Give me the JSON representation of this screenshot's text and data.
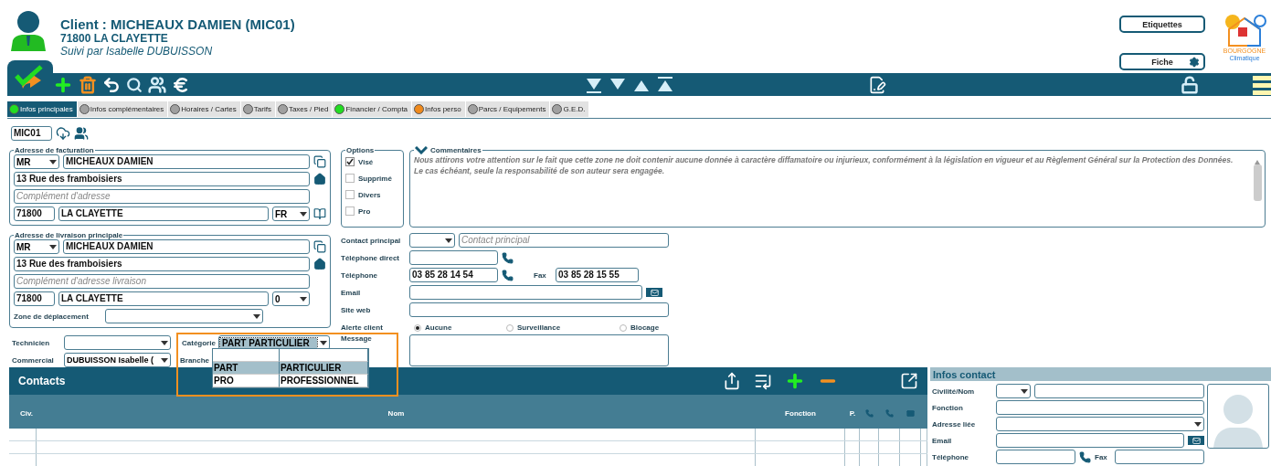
{
  "header": {
    "title": "Client : MICHEAUX DAMIEN (MIC01)",
    "city": "71800 LA CLAYETTE",
    "followed_by": "Suivi par Isabelle DUBUISSON",
    "buttons": [
      "Etiquettes",
      "Fiche"
    ],
    "logo": {
      "line1": "BOURGOGNE",
      "line2": "Climatique"
    }
  },
  "tabs": [
    {
      "label": "Infos principales",
      "color": "#22dd22",
      "selected": true
    },
    {
      "label": "Infos complémentaires",
      "color": "#a0a0a0",
      "selected": false
    },
    {
      "label": "Horaires / Cartes",
      "color": "#a0a0a0",
      "selected": false
    },
    {
      "label": "Tarifs",
      "color": "#a0a0a0",
      "selected": false
    },
    {
      "label": "Taxes / Pied",
      "color": "#a0a0a0",
      "selected": false
    },
    {
      "label": "Financier / Compta",
      "color": "#22dd22",
      "selected": false
    },
    {
      "label": "Infos perso",
      "color": "#f08a1c",
      "selected": false
    },
    {
      "label": "Parcs / Equipements",
      "color": "#a0a0a0",
      "selected": false
    },
    {
      "label": "G.E.D.",
      "color": "#a0a0a0",
      "selected": false
    }
  ],
  "code": "MIC01",
  "billing": {
    "legend": "Adresse de facturation",
    "civility": "MR",
    "name": "MICHEAUX DAMIEN",
    "street": "13 Rue des framboisiers",
    "complement_placeholder": "Complément d'adresse",
    "zip": "71800",
    "city": "LA CLAYETTE",
    "country": "FR"
  },
  "delivery": {
    "legend": "Adresse de livraison principale",
    "civility": "MR",
    "name": "MICHEAUX DAMIEN",
    "street": "13 Rue des framboisiers",
    "complement_placeholder": "Complément d'adresse livraison",
    "zip": "71800",
    "city": "LA CLAYETTE",
    "country": "0",
    "zone_label": "Zone de déplacement"
  },
  "assign": {
    "technician_label": "Technicien",
    "category_label": "Catégorie",
    "category": "PART PARTICULIER",
    "commercial_label": "Commercial",
    "commercial": "DUBUISSON Isabelle (",
    "branch_label": "Branche"
  },
  "category_dropdown": [
    {
      "code": "PART",
      "label": "PARTICULIER",
      "selected": true
    },
    {
      "code": "PRO",
      "label": "PROFESSIONNEL",
      "selected": false
    }
  ],
  "options": {
    "legend": "Options",
    "items": [
      {
        "label": "Visé",
        "checked": true
      },
      {
        "label": "Supprimé",
        "checked": false
      },
      {
        "label": "Divers",
        "checked": false
      },
      {
        "label": "Pro",
        "checked": false
      }
    ]
  },
  "comments": {
    "legend": "Commentaires",
    "text": "Nous attirons votre attention sur le fait que cette zone ne doit contenir aucune donnée à caractère diffamatoire ou injurieux, conformément à la législation en vigueur et au Règlement Général sur la Protection des Données. Le cas échéant, seule la responsabilité de son auteur sera engagée."
  },
  "contact": {
    "principal_label": "Contact principal",
    "principal_placeholder": "Contact principal",
    "direct_label": "Téléphone direct",
    "phone_label": "Téléphone",
    "phone": "03 85 28 14 54",
    "fax_label": "Fax",
    "fax": "03 85 28 15 55",
    "email_label": "Email",
    "web_label": "Site web",
    "alert_label": "Alerte client",
    "alerts": [
      {
        "label": "Aucune",
        "selected": true
      },
      {
        "label": "Surveillance",
        "selected": false
      },
      {
        "label": "Blocage",
        "selected": false
      }
    ],
    "message_label": "Message"
  },
  "contacts": {
    "title": "Contacts",
    "columns": [
      "Civ.",
      "Nom",
      "Fonction",
      "P."
    ]
  },
  "infos_contact": {
    "title": "Infos contact",
    "name_label": "Civilité/Nom",
    "function_label": "Fonction",
    "address_label": "Adresse liée",
    "email_label": "Email",
    "phone_label": "Téléphone",
    "fax_label": "Fax"
  }
}
